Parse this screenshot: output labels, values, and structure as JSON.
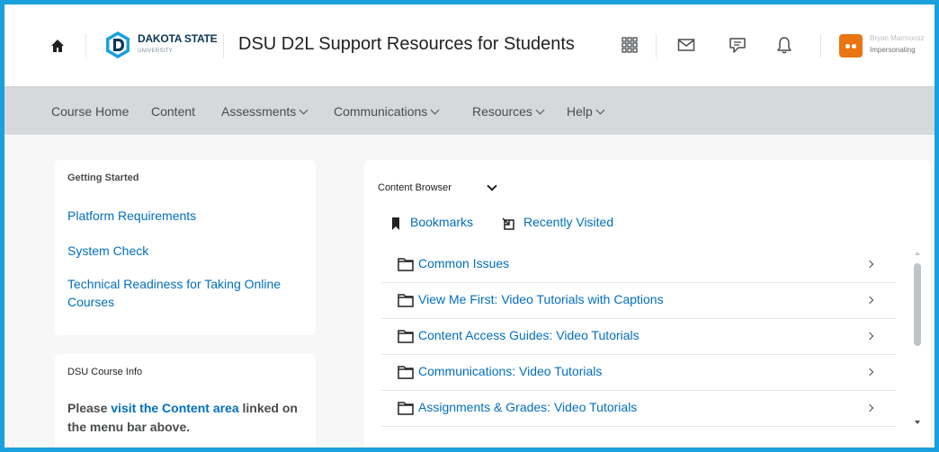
{
  "header": {
    "home_icon": "home-icon",
    "logo": {
      "text": "DAKOTA STATE",
      "subtext": "UNIVERSITY"
    },
    "course_title": "DSU D2L Support Resources for Students",
    "icons": [
      "grid-icon",
      "mail-icon",
      "chat-icon",
      "bell-icon"
    ],
    "user": {
      "name": "Bryan Marmocoz",
      "role": "Impersonating"
    },
    "accent_color": "#1aa0dc"
  },
  "nav": {
    "items": [
      {
        "label": "Course Home"
      },
      {
        "label": "Content"
      },
      {
        "label": "Assessments",
        "dropdown": true
      },
      {
        "label": "Communications",
        "dropdown": true
      },
      {
        "label": "Resources",
        "dropdown": true
      },
      {
        "label": "Help",
        "dropdown": true
      }
    ]
  },
  "getting_started": {
    "title": "Getting Started",
    "links": [
      "Platform Requirements",
      "System Check",
      "Technical Readiness for Taking Online Courses"
    ]
  },
  "course_info": {
    "title": "DSU Course Info",
    "text_before": "Please ",
    "link": "visit the Content area",
    "text_after": " linked on the menu bar above."
  },
  "content_browser": {
    "title": "Content Browser",
    "bookmarks": "Bookmarks",
    "recently_visited": "Recently Visited",
    "items": [
      "Common Issues",
      "View Me First: Video Tutorials with Captions",
      "Content Access Guides: Video Tutorials",
      "Communications: Video Tutorials",
      "Assignments & Grades: Video Tutorials"
    ]
  }
}
